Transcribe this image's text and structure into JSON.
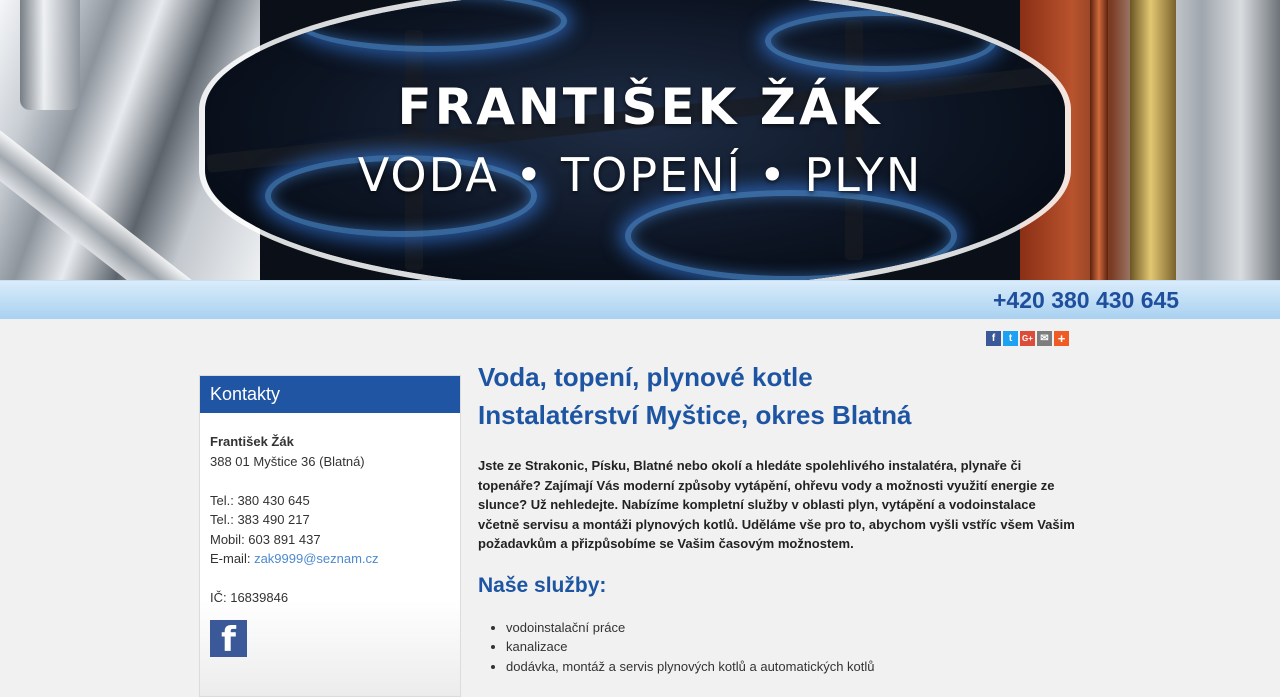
{
  "header": {
    "brand_name": "FRANTIŠEK ŽÁK",
    "brand_tagline": "VODA • TOPENÍ • PLYN",
    "phone": "+420 380 430 645"
  },
  "share": {
    "facebook": "f",
    "twitter": "t",
    "gplus": "G+",
    "email": "✉",
    "more": "+"
  },
  "sidebar": {
    "title": "Kontakty",
    "name": "František Žák",
    "address": "388 01 Myštice 36 (Blatná)",
    "tel1": "Tel.: 380 430 645",
    "tel2": "Tel.: 383 490 217",
    "mobile": "Mobil: 603 891 437",
    "email_label": "E-mail: ",
    "email": "zak9999@seznam.cz",
    "ic": "IČ: 16839846",
    "facebook_icon": "f"
  },
  "main": {
    "heading1": "Voda, topení, plynové kotle",
    "heading2": "Instalatérství Myštice, okres Blatná",
    "intro": "Jste ze Strakonic, Písku, Blatné nebo okolí a hledáte spolehlivého instalatéra, plynaře či topenáře? Zajímají Vás moderní způsoby vytápění, ohřevu vody a možnosti využití energie ze slunce? Už nehledejte. Nabízíme kompletní služby v oblasti plyn, vytápění a vodoinstalace včetně servisu a montáži plynových kotlů. Uděláme vše pro to, abychom vyšli vstříc všem Vašim požadavkům a přizpůsobíme se Vašim časovým možnostem.",
    "services_title": "Naše služby:",
    "services": [
      "vodoinstalační práce",
      "kanalizace",
      "dodávka, montáž a servis plynových kotlů a automatických kotlů"
    ]
  }
}
